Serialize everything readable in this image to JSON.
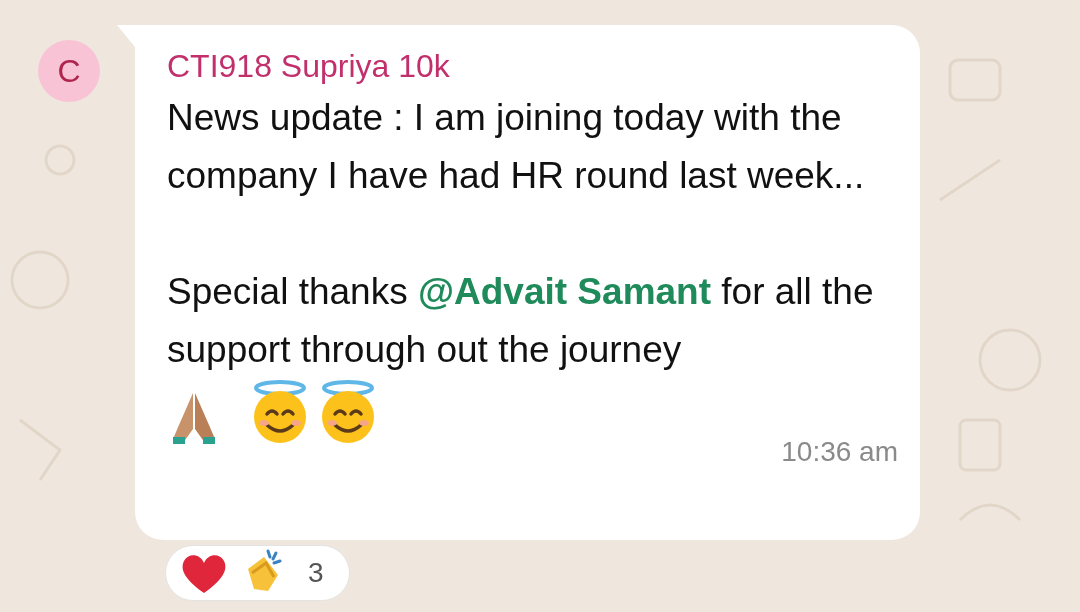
{
  "avatar": {
    "initial": "C"
  },
  "message": {
    "sender": "CTI918 Supriya 10k",
    "paragraphs": [
      [
        {
          "kind": "text",
          "text": "News update : I am joining today with the company I have had HR round last week..."
        }
      ],
      [
        {
          "kind": "text",
          "text": "Special thanks "
        },
        {
          "kind": "mention",
          "text": "@Advait Samant"
        },
        {
          "kind": "text",
          "text": " for all the support through out the journey"
        }
      ]
    ],
    "time": "10:36 am"
  },
  "reactions": {
    "count": "3"
  }
}
